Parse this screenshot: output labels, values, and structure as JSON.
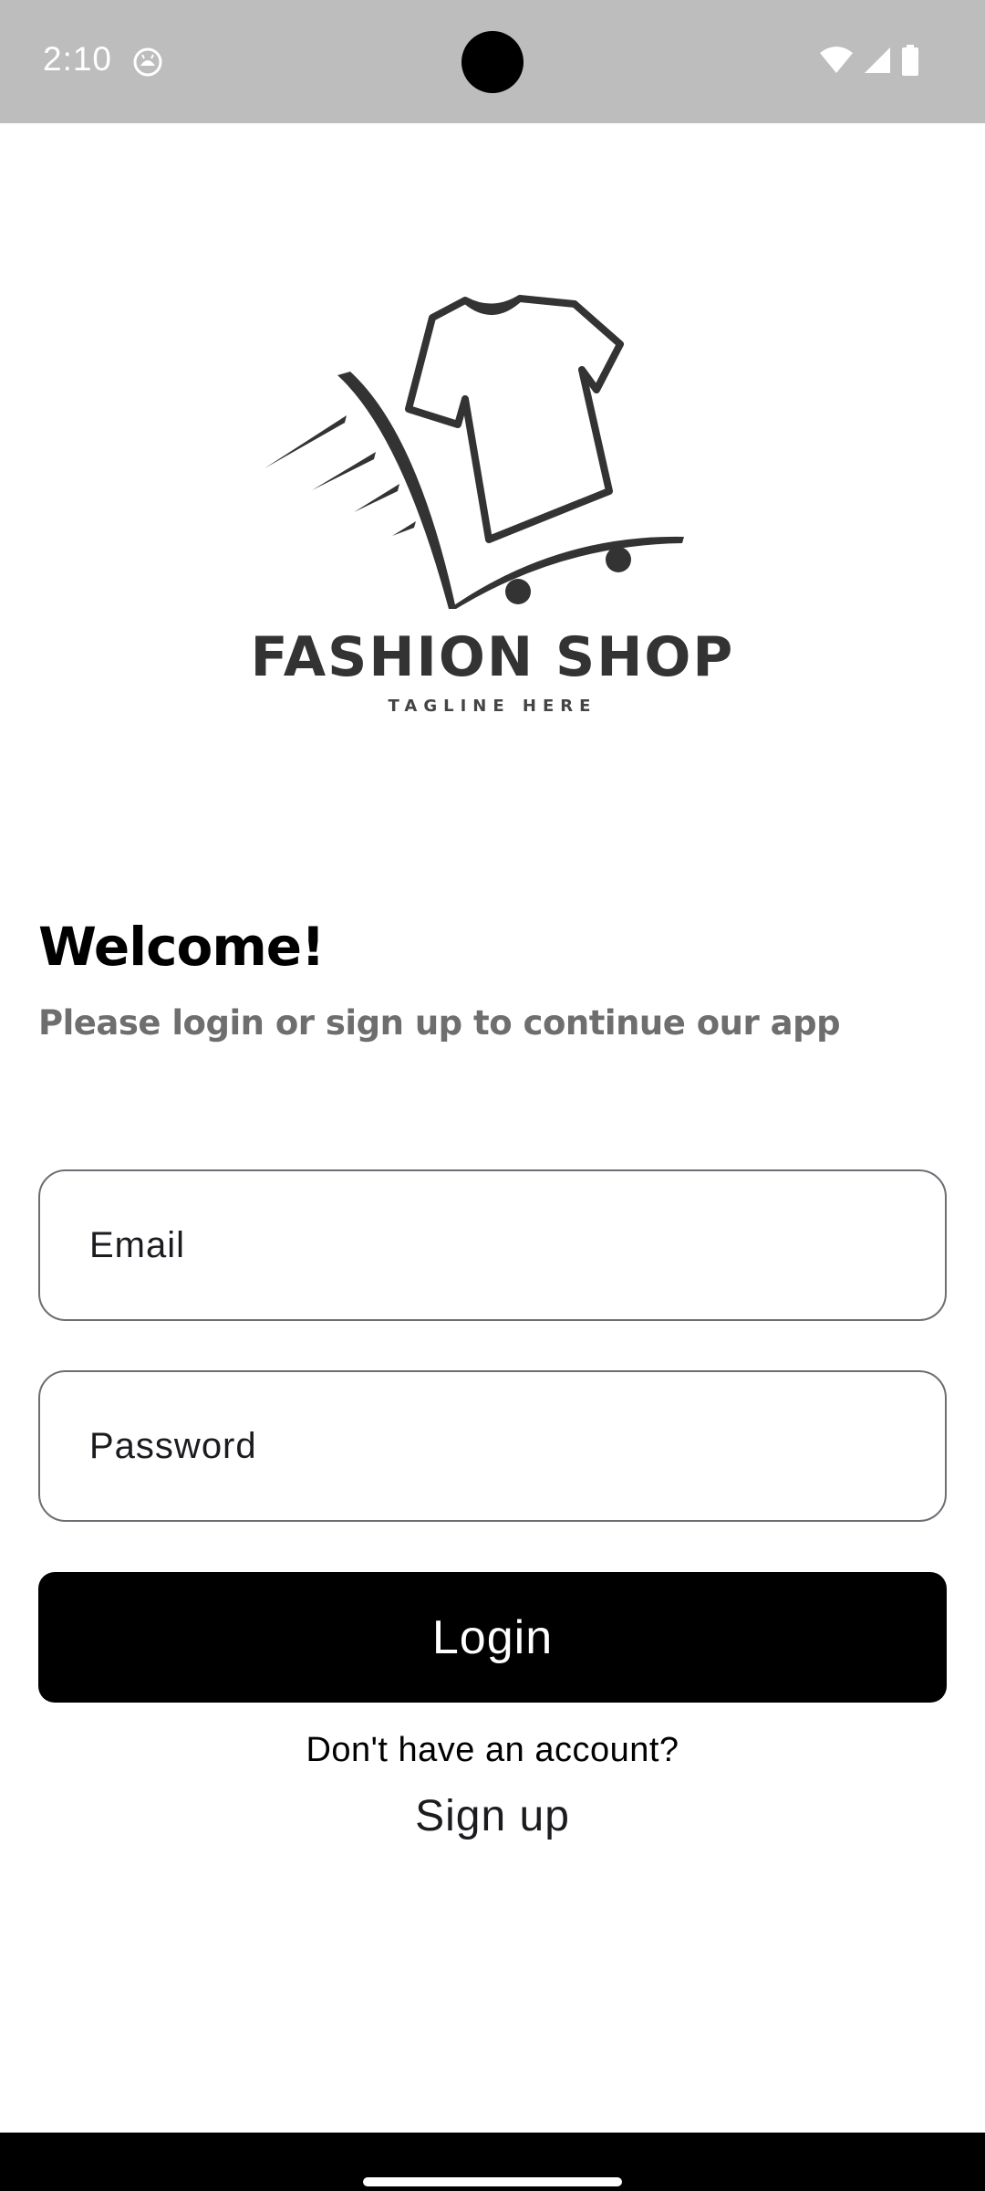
{
  "status_bar": {
    "time": "2:10",
    "app_icon": "android-head-icon",
    "icons": [
      "wifi-icon",
      "signal-icon",
      "battery-icon"
    ]
  },
  "logo": {
    "brand_name": "FASHION SHOP",
    "tagline": "TAGLINE HERE",
    "color": "#333333"
  },
  "welcome": {
    "title": "Welcome!",
    "subtitle": "Please login or sign up to continue our app"
  },
  "form": {
    "email_placeholder": "Email",
    "email_value": "",
    "password_placeholder": "Password",
    "password_value": "",
    "login_label": "Login",
    "no_account_text": "Don't have an account?",
    "signup_label": "Sign up"
  },
  "colors": {
    "status_bar_bg": "#bdbdbd",
    "button_bg": "#000000",
    "button_text": "#ffffff",
    "field_border": "#6f6d74",
    "subtitle": "#6e6e6e"
  }
}
